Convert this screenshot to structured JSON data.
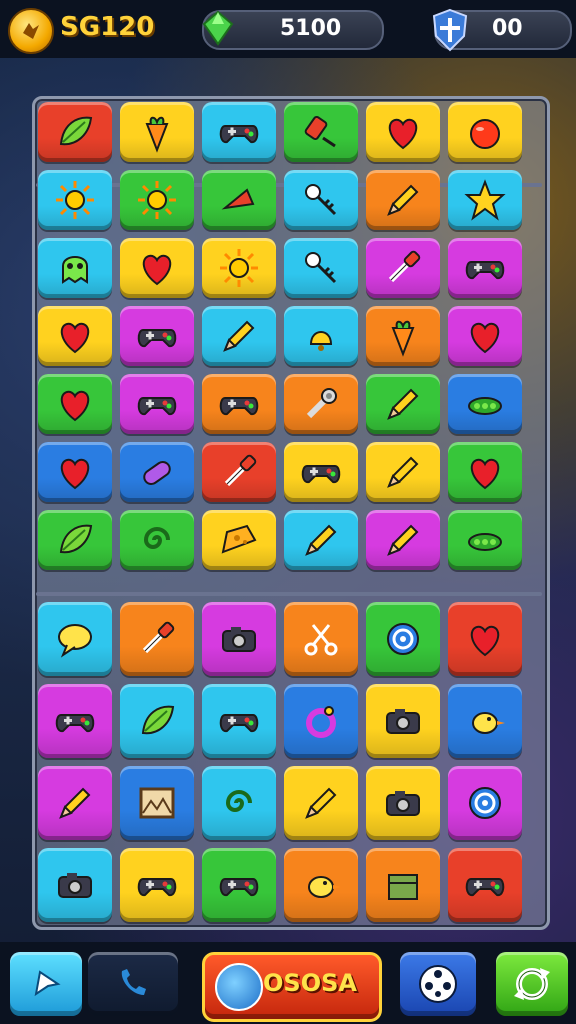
{
  "hud": {
    "score": "SG120",
    "gems": "5100",
    "shields": "00"
  },
  "bottom": {
    "center_label": "OSOSA"
  },
  "colors": {
    "red": "#e8402a",
    "orange": "#f7841c",
    "yellow": "#ffd21f",
    "green": "#37c63a",
    "cyan": "#2fc6ee",
    "blue": "#2a7de2",
    "magenta": "#d63be0",
    "purple": "#8a3de0"
  },
  "grid_top": {
    "rows": [
      [
        "red:leaf-icon",
        "yellow:carrot-icon",
        "cyan:controller-icon",
        "green:toy-icon",
        "yellow:heart-icon",
        "yellow:tomato-icon"
      ],
      [
        "cyan:sun-icon",
        "green:sun-icon",
        "green:horn-icon",
        "cyan:key-icon",
        "orange:paint-icon",
        "cyan:star-icon"
      ],
      [
        "cyan:ghost-icon",
        "yellow:heart-icon",
        "yellow:sun-icon",
        "cyan:key-icon",
        "magenta:pipette-icon",
        "magenta:gamepad-icon"
      ],
      [
        "yellow:heart-icon",
        "magenta:gamepad-icon",
        "cyan:brush-icon",
        "cyan:bell-icon",
        "orange:carrot-icon",
        "magenta:heart-icon"
      ],
      [
        "green:heart-icon",
        "magenta:gamepad-icon",
        "orange:controller-icon",
        "orange:wrench-icon",
        "green:pencil-icon",
        "blue:pea-icon"
      ],
      [
        "blue:heart-icon",
        "blue:capsule-icon",
        "red:pipette-icon",
        "yellow:controller-icon",
        "yellow:tool-icon",
        "green:heart-icon"
      ],
      [
        "green:leaf-icon",
        "green:swirl-icon",
        "yellow:cheese-icon",
        "cyan:pencil-icon",
        "magenta:brush-icon",
        "green:bean-icon"
      ]
    ]
  },
  "grid_bottom": {
    "rows": [
      [
        "cyan:speech-icon",
        "orange:pipette-icon",
        "magenta:camera-icon",
        "orange:scissors-icon",
        "green:target-icon",
        "red:heart-icon"
      ],
      [
        "magenta:gamepad-icon",
        "cyan:leaf-icon",
        "cyan:gamepad-icon",
        "blue:ring-icon",
        "yellow:camera-icon",
        "blue:bird-icon"
      ],
      [
        "magenta:pencil-icon",
        "blue:picture-icon",
        "cyan:swirl-icon",
        "yellow:pencil-icon",
        "yellow:camera-icon",
        "magenta:target-icon"
      ],
      [
        "cyan:camera-icon",
        "yellow:gamepad-icon",
        "green:gamepad-icon",
        "orange:bird-icon",
        "orange:box-icon",
        "red:gamepad-icon"
      ]
    ]
  }
}
